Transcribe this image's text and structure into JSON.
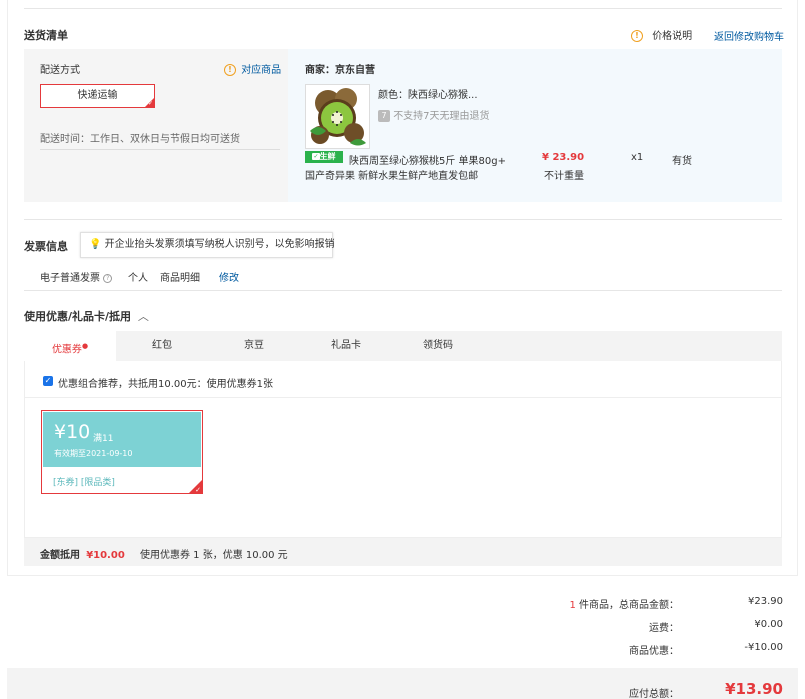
{
  "delivery": {
    "title": "送货清单",
    "price_note": "价格说明",
    "back_to_cart": "返回修改购物车",
    "method_label": "配送方式",
    "match_goods": "对应商品",
    "method_value": "快递运输",
    "time_text": "配送时间：工作日、双休日与节假日均可送货",
    "seller": "商家：京东自营",
    "color_label": "颜色：陕西绿心猕猴...",
    "no_return": "不支持7天无理由退货",
    "fresh_tag": "生鲜",
    "product_name_1": "陕西周至绿心猕猴桃5斤 单果80g+",
    "product_name_2": "国产奇异果 新鲜水果生鲜产地直发包邮",
    "price": "¥ 23.90",
    "weight_note": "不计重量",
    "qty": "x1",
    "stock": "有货"
  },
  "invoice": {
    "title": "发票信息",
    "tip": "开企业抬头发票须填写纳税人识别号，以免影响报销",
    "type": "电子普通发票",
    "person": "个人",
    "detail": "商品明细",
    "edit": "修改"
  },
  "coupons": {
    "title": "使用优惠/礼品卡/抵用",
    "tabs": [
      "优惠券",
      "红包",
      "京豆",
      "礼品卡",
      "领货码"
    ],
    "recommend": "优惠组合推荐，共抵用10.00元：使用优惠券1张",
    "card": {
      "amount": "¥10",
      "threshold": "满11",
      "expiry": "有效期至2021-09-10",
      "tags": "[东券] [限品类]"
    },
    "sum_label": "金额抵用",
    "sum_value": "¥10.00",
    "sum_detail": "使用优惠券 1 张，优惠 10.00 元"
  },
  "summary": {
    "count": "1",
    "count_suffix": "件商品，总商品金额：",
    "goods_amount": "¥23.90",
    "freight_label": "运费：",
    "freight": "¥0.00",
    "discount_label": "商品优惠：",
    "discount": "-¥10.00",
    "payable_label": "应付总额：",
    "payable": "¥13.90"
  },
  "colors": {
    "accent": "#e4393c",
    "link": "#005aa0",
    "coupon": "#7dd2d4",
    "fresh": "#2bb24c"
  }
}
